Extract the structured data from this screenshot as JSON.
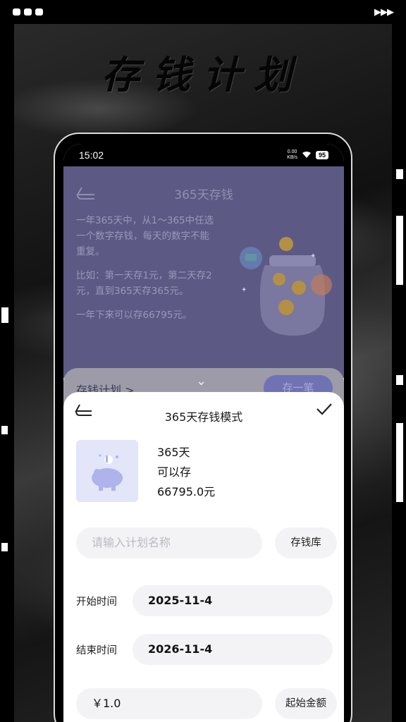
{
  "promo": {
    "title": "存钱计划"
  },
  "status": {
    "time": "15:02",
    "net_speed": "0.00",
    "net_unit": "KB/s",
    "battery": "95"
  },
  "hero": {
    "title": "365天存钱",
    "paragraphs": [
      "一年365天中，从1～365中任选一个数字存钱，每天的数字不能重复。",
      "比如：第一天存1元，第二天存2元，直到365天存365元。",
      "一年下来可以存66795元。"
    ]
  },
  "plan_bar": {
    "label": "存钱计划 >",
    "save_button": "存一笔"
  },
  "sheet": {
    "title": "365天存钱模式",
    "summary": {
      "days": "365天",
      "can_save": "可以存",
      "amount": "66795.0元"
    },
    "name_placeholder": "请输入计划名称",
    "library_button": "存钱库",
    "start_label": "开始时间",
    "start_value": "2025-11-4",
    "end_label": "结束时间",
    "end_value": "2026-11-4",
    "amount_value": "￥1.0",
    "amount_button": "起始金额"
  },
  "colors": {
    "hero_bg": "#5c5a84",
    "accent": "#6f72b4",
    "thumb_bg": "#e3e5f8"
  }
}
